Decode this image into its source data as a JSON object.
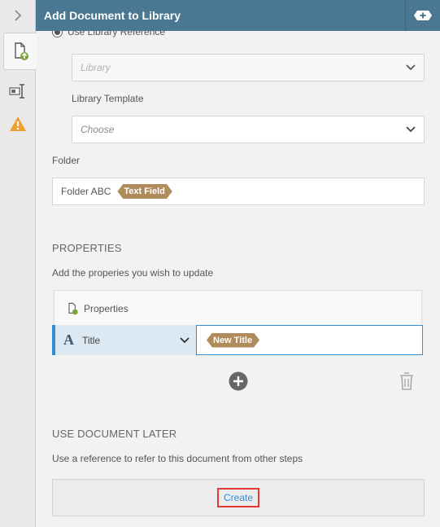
{
  "header": {
    "title": "Add Document to Library"
  },
  "form": {
    "library_reference_label": "Use Library Reference",
    "library_placeholder": "Library",
    "template_label": "Library Template",
    "template_placeholder": "Choose",
    "folder_label": "Folder",
    "folder_value": "Folder ABC",
    "folder_token": "Text Field"
  },
  "properties": {
    "section_title": "PROPERTIES",
    "description": "Add the properies you wish to update",
    "card_label": "Properties",
    "row": {
      "icon_letter": "A",
      "name": "Title",
      "value_token": "New Title"
    }
  },
  "use_later": {
    "section_title": "USE DOCUMENT LATER",
    "description": "Use a reference to refer to this document from other steps",
    "create_label": "Create"
  },
  "colors": {
    "header_bg": "#4a7893",
    "accent_blue": "#2e8fd6",
    "token_bg": "#b08c5c",
    "highlight_red": "#e53935",
    "warning_orange": "#f0a030"
  }
}
